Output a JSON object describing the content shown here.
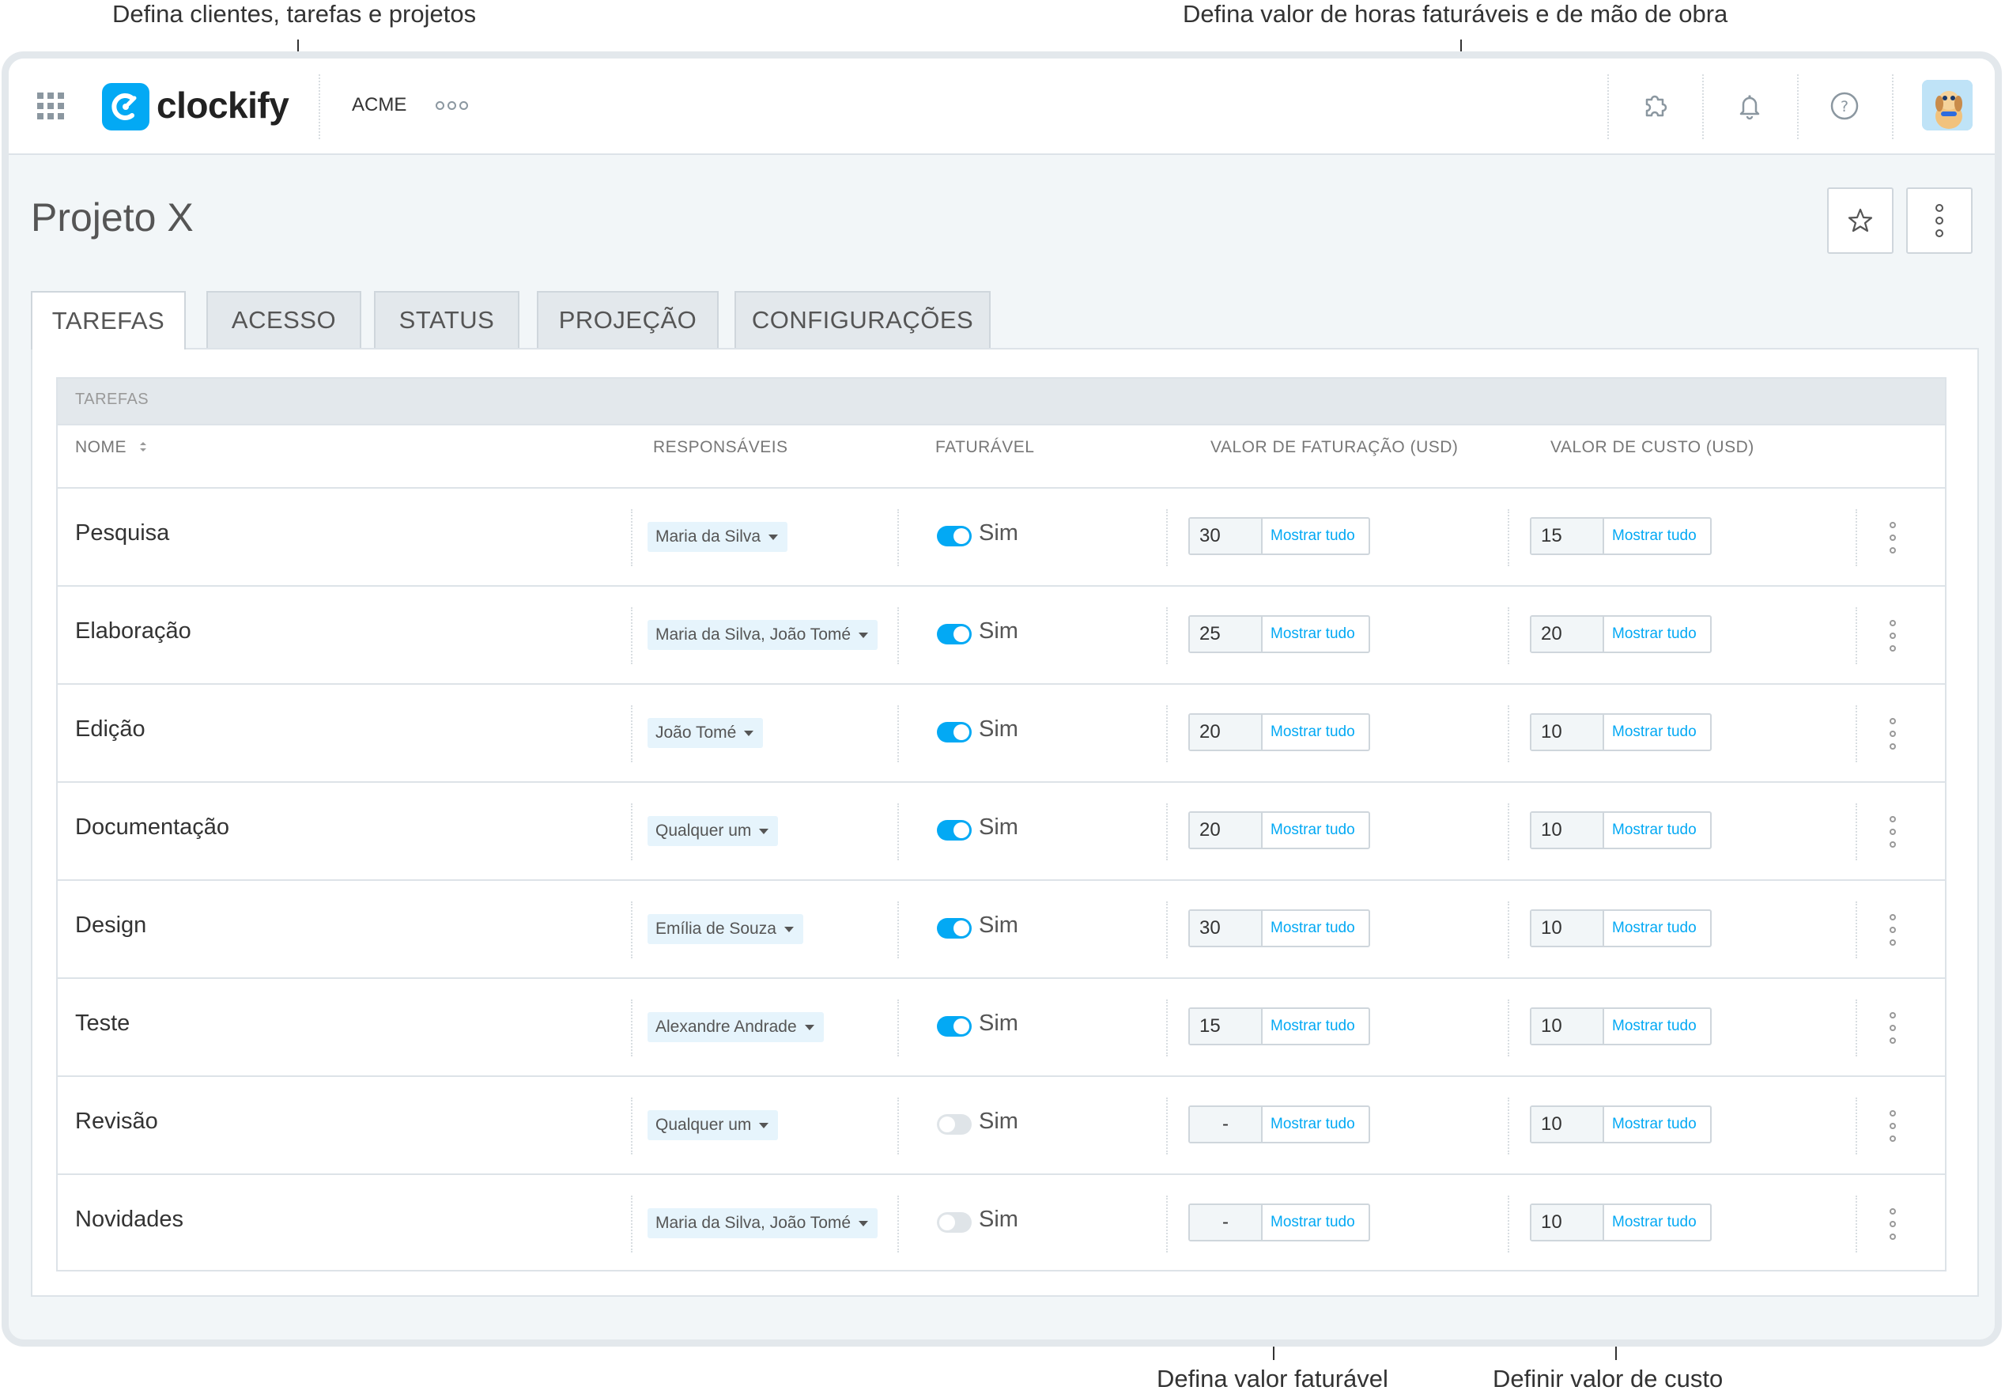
{
  "callouts": {
    "clients": "Defina clientes, tarefas e projetos",
    "rates": "Defina valor de horas faturáveis e de mão de obra",
    "billable": "Defina valor faturável",
    "cost": "Definir valor de custo"
  },
  "topbar": {
    "brand": "clockify",
    "workspace": "ACME",
    "icons": [
      "apps-grid-icon",
      "integrations-icon",
      "bell-icon",
      "help-icon"
    ]
  },
  "page": {
    "title": "Projeto X"
  },
  "tabs": [
    "TAREFAS",
    "ACESSO",
    "STATUS",
    "PROJEÇÃO",
    "CONFIGURAÇÕES"
  ],
  "table": {
    "section_title": "TAREFAS",
    "columns": {
      "name": "NOME",
      "assignees": "RESPONSÁVEIS",
      "billable": "FATURÁVEL",
      "billable_rate": "VALOR DE FATURAÇÃO (USD)",
      "cost_rate": "VALOR DE CUSTO (USD)"
    },
    "show_all": "Mostrar tudo",
    "rows": [
      {
        "name": "Pesquisa",
        "assignees": "Maria da Silva",
        "billable": true,
        "billable_label": "Sim",
        "billable_rate": "30",
        "cost_rate": "15"
      },
      {
        "name": "Elaboração",
        "assignees": "Maria da Silva, João Tomé",
        "billable": true,
        "billable_label": "Sim",
        "billable_rate": "25",
        "cost_rate": "20"
      },
      {
        "name": "Edição",
        "assignees": "João Tomé",
        "billable": true,
        "billable_label": "Sim",
        "billable_rate": "20",
        "cost_rate": "10"
      },
      {
        "name": "Documentação",
        "assignees": "Qualquer um",
        "billable": true,
        "billable_label": "Sim",
        "billable_rate": "20",
        "cost_rate": "10"
      },
      {
        "name": "Design",
        "assignees": "Emília de Souza",
        "billable": true,
        "billable_label": "Sim",
        "billable_rate": "30",
        "cost_rate": "10"
      },
      {
        "name": "Teste",
        "assignees": "Alexandre Andrade",
        "billable": true,
        "billable_label": "Sim",
        "billable_rate": "15",
        "cost_rate": "10"
      },
      {
        "name": "Revisão",
        "assignees": "Qualquer um",
        "billable": false,
        "billable_label": "Sim",
        "billable_rate": "-",
        "cost_rate": "10"
      },
      {
        "name": "Novidades",
        "assignees": "Maria da Silva, João Tomé",
        "billable": false,
        "billable_label": "Sim",
        "billable_rate": "-",
        "cost_rate": "10"
      }
    ]
  },
  "colors": {
    "accent": "#03a9f4",
    "frame": "#e3e8ec",
    "background": "#f2f6f8"
  }
}
